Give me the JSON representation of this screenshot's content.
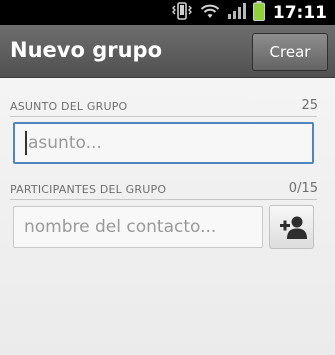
{
  "status_bar": {
    "time": "17:11",
    "icons": [
      "vibrate-icon",
      "wifi-icon",
      "signal-icon",
      "battery-icon"
    ],
    "battery_color": "#8ed138"
  },
  "action_bar": {
    "title": "Nuevo grupo",
    "create_button_label": "Crear"
  },
  "subject_section": {
    "label": "ASUNTO DEL GRUPO",
    "remaining_chars": "25",
    "input_placeholder": "asunto...",
    "input_value": ""
  },
  "participants_section": {
    "label": "PARTICIPANTES DEL GRUPO",
    "count": "0/15",
    "input_placeholder": "nombre del contacto...",
    "input_value": "",
    "add_button_icon": "add-contact-icon"
  },
  "colors": {
    "focus_border": "#4f86bf",
    "action_bar": "#5e5e5e"
  }
}
